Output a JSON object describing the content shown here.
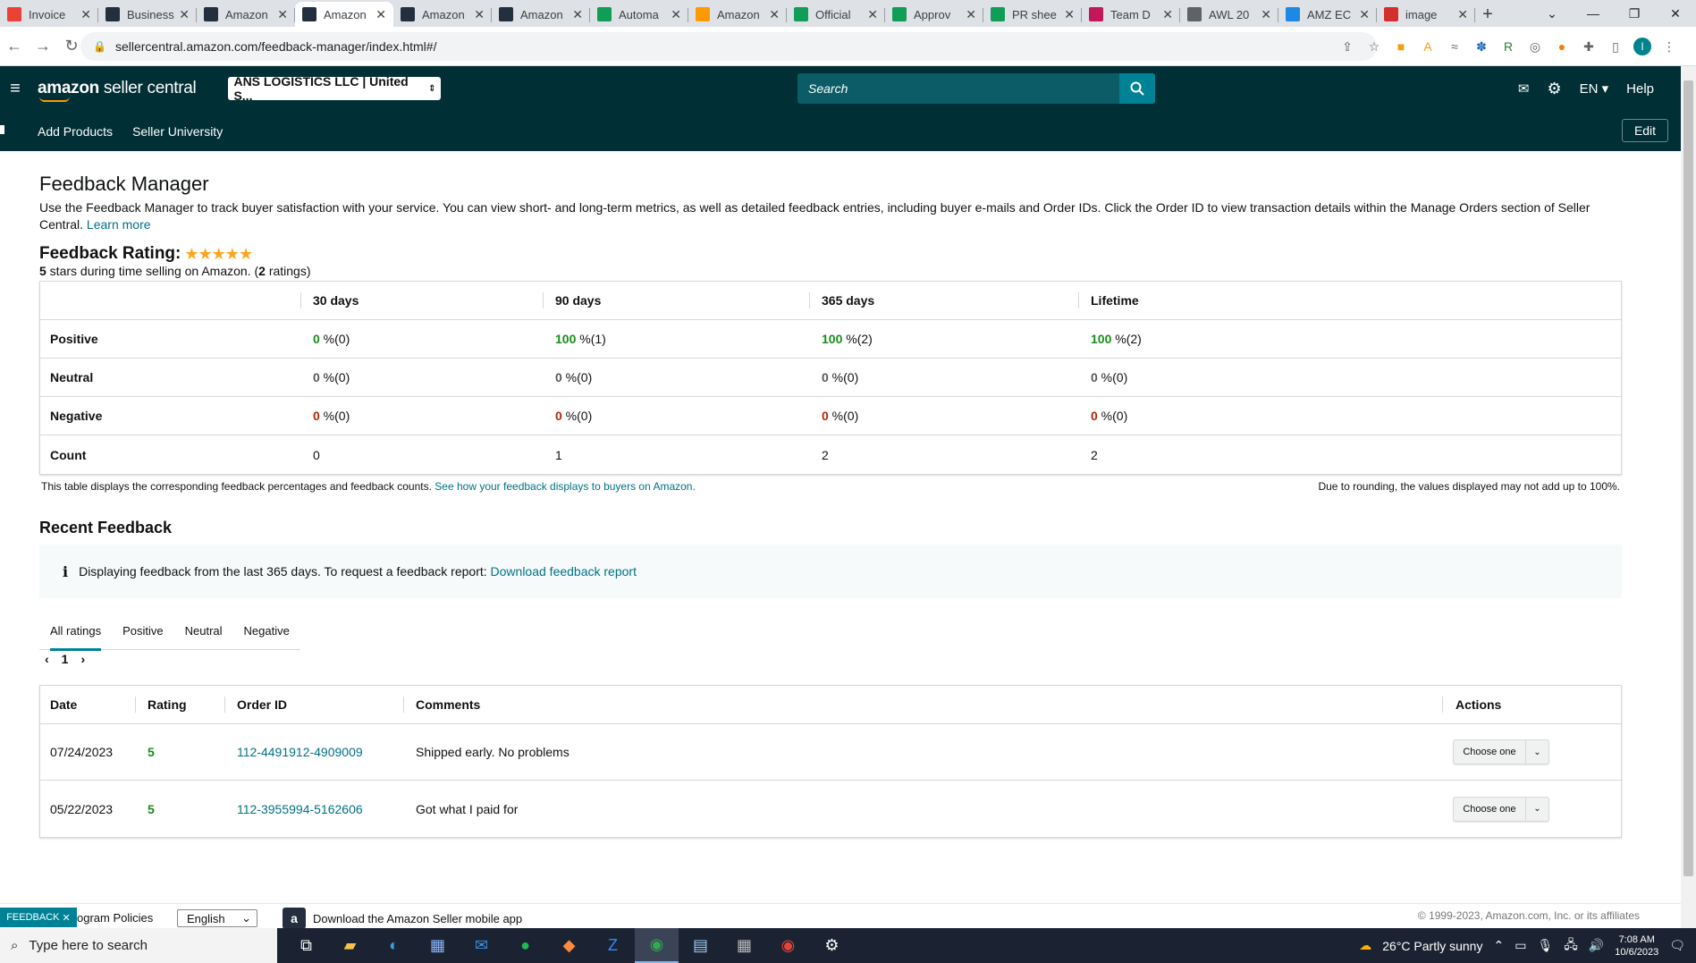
{
  "browser": {
    "tabs": [
      {
        "title": "Invoice",
        "icon": "gmail-icon",
        "color": "#ea4335"
      },
      {
        "title": "Business",
        "icon": "amazon-icon",
        "color": "#232f3e"
      },
      {
        "title": "Amazon",
        "icon": "amazon-icon",
        "color": "#232f3e"
      },
      {
        "title": "Amazon",
        "icon": "amazon-icon",
        "color": "#232f3e",
        "active": true
      },
      {
        "title": "Amazon",
        "icon": "amazon-icon",
        "color": "#232f3e"
      },
      {
        "title": "Amazon",
        "icon": "amazon-icon",
        "color": "#232f3e"
      },
      {
        "title": "Automa",
        "icon": "sheets-icon",
        "color": "#0f9d58"
      },
      {
        "title": "Amazon",
        "icon": "amazon-icon",
        "color": "#ff9900"
      },
      {
        "title": "Official",
        "icon": "sheets-icon",
        "color": "#0f9d58"
      },
      {
        "title": "Approv",
        "icon": "sheets-icon",
        "color": "#0f9d58"
      },
      {
        "title": "PR shee",
        "icon": "sheets-icon",
        "color": "#0f9d58"
      },
      {
        "title": "Team D",
        "icon": "teamdesk-icon",
        "color": "#c2185b"
      },
      {
        "title": "AWL 20",
        "icon": "globe-icon",
        "color": "#5f6368"
      },
      {
        "title": "AMZ EC",
        "icon": "amz-icon",
        "color": "#1e88e5"
      },
      {
        "title": "image",
        "icon": "vivaldi-icon",
        "color": "#d32f2f"
      }
    ],
    "url": "sellercentral.amazon.com/feedback-manager/index.html#/",
    "profile_initial": "I"
  },
  "header": {
    "logo_bold": "amazon",
    "logo_rest": " seller central",
    "account": "ANS LOGISTICS LLC | United S...",
    "search_placeholder": "Search",
    "language": "EN",
    "help": "Help",
    "nav": [
      "Add Products",
      "Seller University"
    ],
    "edit": "Edit"
  },
  "page": {
    "title": "Feedback Manager",
    "description": "Use the Feedback Manager to track buyer satisfaction with your service. You can view short- and long-term metrics, as well as detailed feedback entries, including buyer e-mails and Order IDs. Click the Order ID to view transaction details within the Manage Orders section of Seller Central.",
    "learn_more": "Learn more",
    "rating_label": "Feedback Rating:",
    "rating_stars": 5,
    "rating_sub_value": "5",
    "rating_sub_mid": " stars during time selling on Amazon. (",
    "rating_sub_count": "2",
    "rating_sub_end": " ratings)"
  },
  "metrics": {
    "columns": [
      "30 days",
      "90 days",
      "365 days",
      "Lifetime"
    ],
    "rows": [
      {
        "label": "Positive",
        "cells": [
          {
            "v": "0",
            "s": " %(0)",
            "c": "green"
          },
          {
            "v": "100",
            "s": " %(1)",
            "c": "green"
          },
          {
            "v": "100",
            "s": " %(2)",
            "c": "green"
          },
          {
            "v": "100",
            "s": " %(2)",
            "c": "green"
          }
        ]
      },
      {
        "label": "Neutral",
        "cells": [
          {
            "v": "0",
            "s": " %(0)",
            "c": "gray"
          },
          {
            "v": "0",
            "s": " %(0)",
            "c": "gray"
          },
          {
            "v": "0",
            "s": " %(0)",
            "c": "gray"
          },
          {
            "v": "0",
            "s": " %(0)",
            "c": "gray"
          }
        ]
      },
      {
        "label": "Negative",
        "cells": [
          {
            "v": "0",
            "s": " %(0)",
            "c": "red"
          },
          {
            "v": "0",
            "s": " %(0)",
            "c": "red"
          },
          {
            "v": "0",
            "s": " %(0)",
            "c": "red"
          },
          {
            "v": "0",
            "s": " %(0)",
            "c": "red"
          }
        ]
      },
      {
        "label": "Count",
        "cells": [
          {
            "v": "",
            "s": "0",
            "c": ""
          },
          {
            "v": "",
            "s": "1",
            "c": ""
          },
          {
            "v": "",
            "s": "2",
            "c": ""
          },
          {
            "v": "",
            "s": "2",
            "c": ""
          }
        ]
      }
    ],
    "note_left": "This table displays the corresponding feedback percentages and feedback counts.",
    "note_link": "See how your feedback displays to buyers on Amazon.",
    "note_right": "Due to rounding, the values displayed may not add up to 100%."
  },
  "recent": {
    "title": "Recent Feedback",
    "info_text": "Displaying feedback from the last 365 days. To request a feedback report:",
    "info_link": "Download feedback report",
    "tabs": [
      "All ratings",
      "Positive",
      "Neutral",
      "Negative"
    ],
    "page": "1",
    "columns": [
      "Date",
      "Rating",
      "Order ID",
      "Comments",
      "Actions"
    ],
    "rows": [
      {
        "date": "07/24/2023",
        "rating": "5",
        "order": "112-4491912-4909009",
        "comment": "Shipped early. No problems",
        "action": "Choose one"
      },
      {
        "date": "05/22/2023",
        "rating": "5",
        "order": "112-3955994-5162606",
        "comment": "Got what I paid for",
        "action": "Choose one"
      }
    ]
  },
  "footer": {
    "feedback_tag": "FEEDBACK",
    "program_policies": "ogram Policies",
    "language": "English",
    "app_download": "Download the Amazon Seller mobile app",
    "copyright": "© 1999-2023, Amazon.com, Inc. or its affiliates"
  },
  "taskbar": {
    "search_placeholder": "Type here to search",
    "weather": "26°C  Partly sunny",
    "time": "7:08 AM",
    "date": "10/6/2023"
  }
}
